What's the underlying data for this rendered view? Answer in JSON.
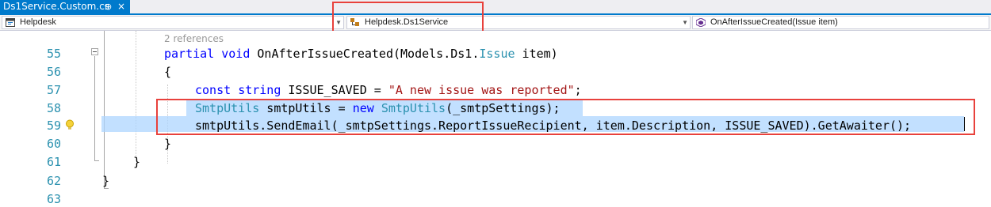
{
  "tab": {
    "title": "Ds1Service.Custom.cs",
    "pin_glyph": "⊕",
    "close_glyph": "×"
  },
  "nav": {
    "project": "Helpdesk",
    "type": "Helpdesk.Ds1Service",
    "member": "OnAfterIssueCreated(Issue item)"
  },
  "editor": {
    "codelens": "2 references",
    "lines": [
      {
        "num": "55",
        "tokens": [
          {
            "t": "partial ",
            "c": "kw"
          },
          {
            "t": "void ",
            "c": "kw"
          },
          {
            "t": "OnAfterIssueCreated(Models.Ds1.",
            "c": ""
          },
          {
            "t": "Issue",
            "c": "ty"
          },
          {
            "t": " item)",
            "c": ""
          }
        ]
      },
      {
        "num": "56",
        "tokens": [
          {
            "t": "{",
            "c": ""
          }
        ]
      },
      {
        "num": "57",
        "tokens": [
          {
            "t": "const ",
            "c": "kw"
          },
          {
            "t": "string ",
            "c": "kw"
          },
          {
            "t": "ISSUE_SAVED = ",
            "c": ""
          },
          {
            "t": "\"A new issue was reported\"",
            "c": "str"
          },
          {
            "t": ";",
            "c": ""
          }
        ]
      },
      {
        "num": "58",
        "tokens": [
          {
            "t": "SmtpUtils",
            "c": "ty"
          },
          {
            "t": " smtpUtils = ",
            "c": ""
          },
          {
            "t": "new ",
            "c": "kw"
          },
          {
            "t": "SmtpUtils",
            "c": "ty"
          },
          {
            "t": "(_smtpSettings);",
            "c": ""
          }
        ]
      },
      {
        "num": "59",
        "tokens": [
          {
            "t": "smtpUtils.SendEmail(_smtpSettings.ReportIssueRecipient, item.Description, ISSUE_SAVED).GetAwaiter();",
            "c": ""
          }
        ]
      },
      {
        "num": "60",
        "tokens": [
          {
            "t": "}",
            "c": ""
          }
        ]
      },
      {
        "num": "61",
        "tokens": [
          {
            "t": "}",
            "c": ""
          }
        ]
      },
      {
        "num": "62",
        "tokens": [
          {
            "t": "}",
            "c": ""
          }
        ]
      },
      {
        "num": "63",
        "tokens": []
      }
    ]
  },
  "colors": {
    "accent": "#007acc",
    "highlight_frame": "#e8413c",
    "selection": "#add6ff",
    "keyword": "#0000ff",
    "type": "#2b91af",
    "string": "#a31515"
  }
}
